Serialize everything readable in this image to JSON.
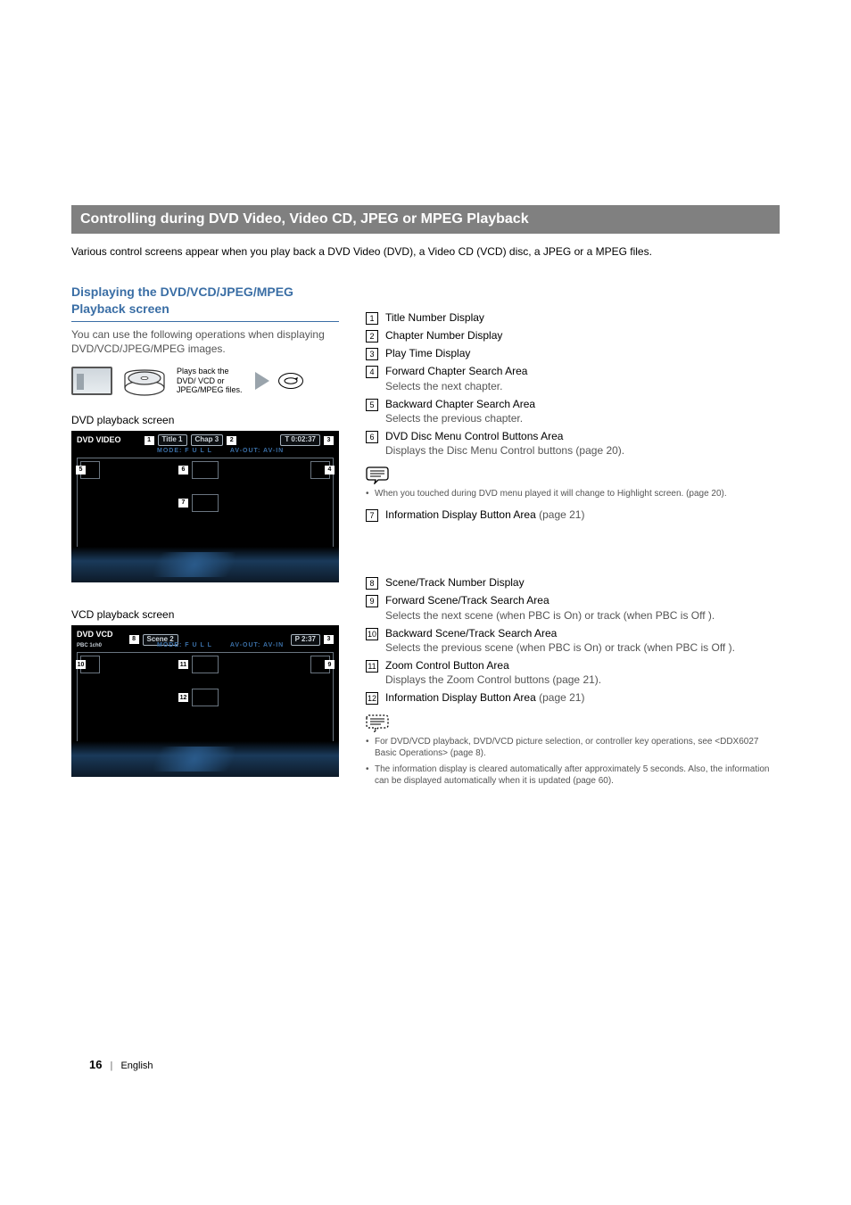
{
  "section_title": "Controlling during DVD Video, Video CD, JPEG or MPEG Playback",
  "intro": "Various control screens appear when you play back a DVD Video (DVD), a Video CD (VCD) disc, a JPEG or a MPEG files.",
  "panel": {
    "title": "Displaying the DVD/VCD/JPEG/MPEG Playback screen",
    "desc": "You can use the following operations when displaying DVD/VCD/JPEG/MPEG images.",
    "media_caption": "Plays back the DVD/ VCD or JPEG/MPEG files."
  },
  "dvd_screen_label": "DVD playback screen",
  "vcd_screen_label": "VCD playback screen",
  "dvd_topbar": {
    "source": "DVD VIDEO",
    "title_pill": "Title 1",
    "chap_pill": "Chap 3",
    "time_pill": "T   0:02:37",
    "mode": "MODE: F U L L",
    "avout": "AV-OUT: AV-IN",
    "callouts": {
      "c1": "1",
      "c2": "2",
      "c3": "3",
      "c4": "4",
      "c5": "5",
      "c6": "6",
      "c7": "7"
    }
  },
  "vcd_topbar": {
    "source": "DVD VCD",
    "sub": "PBC      1ch0",
    "scene_pill": "Scene     2",
    "time_pill": "P   2:37",
    "mode": "MODE: F U L L",
    "avout": "AV-OUT: AV-IN",
    "callouts": {
      "c3": "3",
      "c8": "8",
      "c9": "9",
      "c10": "10",
      "c11": "11",
      "c12": "12"
    }
  },
  "defs_dvd": [
    {
      "num": "1",
      "title": "Title Number Display"
    },
    {
      "num": "2",
      "title": "Chapter Number Display"
    },
    {
      "num": "3",
      "title": "Play Time Display"
    },
    {
      "num": "4",
      "title": "Forward Chapter Search Area",
      "sub": "Selects the next chapter."
    },
    {
      "num": "5",
      "title": "Backward Chapter Search Area",
      "sub": "Selects the previous chapter."
    },
    {
      "num": "6",
      "title": "DVD Disc Menu Control Buttons Area",
      "sub": "Displays the Disc Menu Control buttons (page 20)."
    }
  ],
  "note_dvd": [
    "When you touched during DVD menu played it will change to Highlight screen. (page 20)."
  ],
  "defs_dvd_tail": [
    {
      "num": "7",
      "title": "Information Display Button Area",
      "tail": " (page 21)"
    }
  ],
  "defs_vcd": [
    {
      "num": "8",
      "title": "Scene/Track Number Display"
    },
    {
      "num": "9",
      "title": "Forward Scene/Track Search Area",
      "sub": "Selects the next scene (when PBC is On) or track (when PBC is Off )."
    },
    {
      "num": "10",
      "title": "Backward Scene/Track Search Area",
      "sub": "Selects the previous scene (when PBC is On) or track (when PBC is Off )."
    },
    {
      "num": "11",
      "title": "Zoom Control Button Area",
      "sub": "Displays the Zoom Control buttons (page 21)."
    },
    {
      "num": "12",
      "title": "Information Display Button Area",
      "tail": " (page 21)"
    }
  ],
  "note_vcd": [
    "For DVD/VCD playback, DVD/VCD picture selection, or controller key operations, see <DDX6027 Basic Operations> (page 8).",
    "The information display is cleared automatically after approximately 5 seconds. Also, the information can be displayed automatically when it is updated (page 60)."
  ],
  "footer": {
    "page": "16",
    "lang": "English"
  }
}
